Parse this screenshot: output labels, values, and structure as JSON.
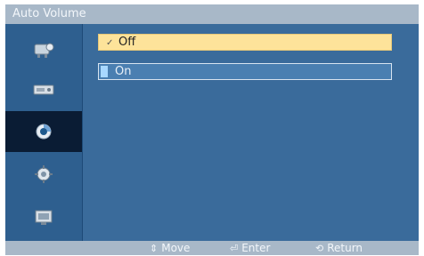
{
  "title": "Auto Volume",
  "options": [
    {
      "label": "Off",
      "selected": true
    },
    {
      "label": "On",
      "selected": false
    }
  ],
  "sidebar": {
    "items": [
      {
        "icon": "picture-icon",
        "active": false
      },
      {
        "icon": "sound-icon",
        "active": false
      },
      {
        "icon": "setup-icon",
        "active": true
      },
      {
        "icon": "gear-icon",
        "active": false
      },
      {
        "icon": "input-icon",
        "active": false
      }
    ]
  },
  "footer": {
    "move": {
      "icon": "up-down-arrow-icon",
      "label": "Move"
    },
    "enter": {
      "icon": "enter-icon",
      "label": "Enter"
    },
    "return": {
      "icon": "return-icon",
      "label": "Return"
    }
  },
  "colors": {
    "panel": "#3a6b9b",
    "sidebar": "#2e5f8f",
    "active_item": "#0a1c34",
    "highlight": "#fde39a",
    "title_bar": "#a8b8c8"
  }
}
